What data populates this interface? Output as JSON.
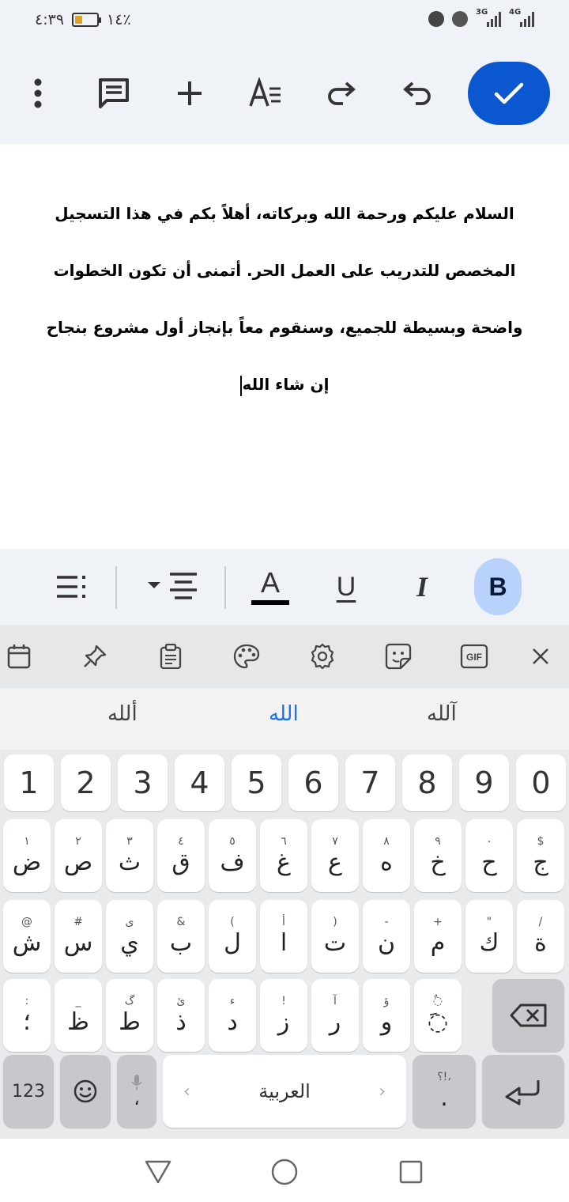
{
  "status": {
    "time": "٤:٣٩",
    "battery": "١٤٪",
    "net1": "3G",
    "net2": "4G"
  },
  "toolbar": {
    "more": "more-vert-icon",
    "comment": "comment-icon",
    "insert": "add-icon",
    "text_format": "text-format-icon",
    "redo": "redo-icon",
    "undo": "undo-icon",
    "done": "check-icon",
    "accent": "#0b57d0"
  },
  "document": {
    "text": "السلام عليكم ورحمة الله وبركاته، أهلاً بكم في هذا التسجيل المخصص للتدريب على العمل الحر. أتمنى أن تكون الخطوات واضحة وبسيطة للجميع، وسنقوم معاً بإنجاز أول مشروع بنجاح إن شاء الله"
  },
  "format_bar": {
    "text_color_label": "A",
    "underline_label": "U",
    "italic_label": "I",
    "bold_label": "B",
    "bold_active": true
  },
  "suggestions": [
    "آلله",
    "الله",
    "ألله"
  ],
  "keyboard": {
    "numbers": [
      "1",
      "2",
      "3",
      "4",
      "5",
      "6",
      "7",
      "8",
      "9",
      "0"
    ],
    "row1": [
      {
        "main": "ض",
        "hint": "١"
      },
      {
        "main": "ص",
        "hint": "٢"
      },
      {
        "main": "ث",
        "hint": "٣"
      },
      {
        "main": "ق",
        "hint": "٤"
      },
      {
        "main": "ف",
        "hint": "٥"
      },
      {
        "main": "غ",
        "hint": "٦"
      },
      {
        "main": "ع",
        "hint": "٧"
      },
      {
        "main": "ه",
        "hint": "٨"
      },
      {
        "main": "خ",
        "hint": "٩"
      },
      {
        "main": "ح",
        "hint": "٠"
      },
      {
        "main": "ج",
        "hint": "$"
      }
    ],
    "row2": [
      {
        "main": "ش",
        "hint": "@"
      },
      {
        "main": "س",
        "hint": "#"
      },
      {
        "main": "ي",
        "hint": "ى"
      },
      {
        "main": "ب",
        "hint": "&"
      },
      {
        "main": "ل",
        "hint": "("
      },
      {
        "main": "ا",
        "hint": "أ"
      },
      {
        "main": "ت",
        "hint": ")"
      },
      {
        "main": "ن",
        "hint": "-"
      },
      {
        "main": "م",
        "hint": "+"
      },
      {
        "main": "ك",
        "hint": "\""
      },
      {
        "main": "ة",
        "hint": "/"
      }
    ],
    "row3": [
      {
        "main": "؛",
        "hint": ":"
      },
      {
        "main": "ظ",
        "hint": "_"
      },
      {
        "main": "ط",
        "hint": "گ"
      },
      {
        "main": "ذ",
        "hint": "ئ"
      },
      {
        "main": "د",
        "hint": "ء"
      },
      {
        "main": "ز",
        "hint": "!"
      },
      {
        "main": "ر",
        "hint": "آ"
      },
      {
        "main": "و",
        "hint": "ؤ"
      },
      {
        "main": "◌َ",
        "hint": "◌ٌ"
      }
    ],
    "mode_label": "123",
    "comma_label": "،",
    "space_label": "العربية",
    "period_label": ".",
    "period_hint": "؟!،"
  }
}
